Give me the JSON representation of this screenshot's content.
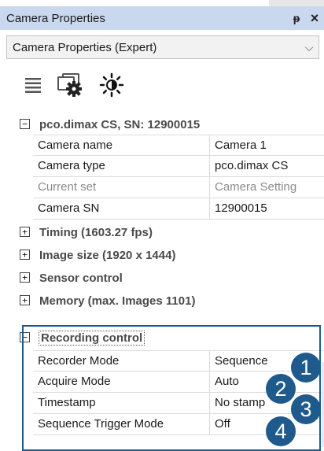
{
  "panel": {
    "title": "Camera Properties",
    "pin_icon": "pin-icon",
    "close_icon": "close-icon"
  },
  "dropdown": {
    "selected": "Camera Properties (Expert)"
  },
  "toolbar": {
    "icons": [
      "list-icon",
      "camera-settings-icon",
      "brightness-icon"
    ]
  },
  "tree": {
    "root": {
      "label": "pco.dimax CS, SN: 12900015",
      "expanded": true,
      "properties": [
        {
          "name": "Camera name",
          "value": "Camera 1",
          "enabled": true
        },
        {
          "name": "Camera type",
          "value": "pco.dimax CS",
          "enabled": true
        },
        {
          "name": "Current set",
          "value": "Camera Setting",
          "enabled": false
        },
        {
          "name": "Camera SN",
          "value": "12900015",
          "enabled": true
        }
      ]
    },
    "categories": [
      {
        "label": "Timing (1603.27 fps)",
        "expanded": false
      },
      {
        "label": "Image size (1920 x 1444)",
        "expanded": false
      },
      {
        "label": "Sensor control",
        "expanded": false
      },
      {
        "label": "Memory (max. Images 1101)",
        "expanded": false
      }
    ],
    "recording": {
      "label": "Recording control",
      "expanded": true,
      "properties": [
        {
          "name": "Recorder Mode",
          "value": "Sequence"
        },
        {
          "name": "Acquire Mode",
          "value": "Auto"
        },
        {
          "name": "Timestamp",
          "value": "No stamp"
        },
        {
          "name": "Sequence Trigger Mode",
          "value": "Off"
        }
      ]
    }
  },
  "markers": [
    "1",
    "2",
    "3",
    "4"
  ],
  "colors": {
    "titlebar": "#cad8ef",
    "accent": "#1f5a8c",
    "disabled_text": "#8a8a8a"
  }
}
